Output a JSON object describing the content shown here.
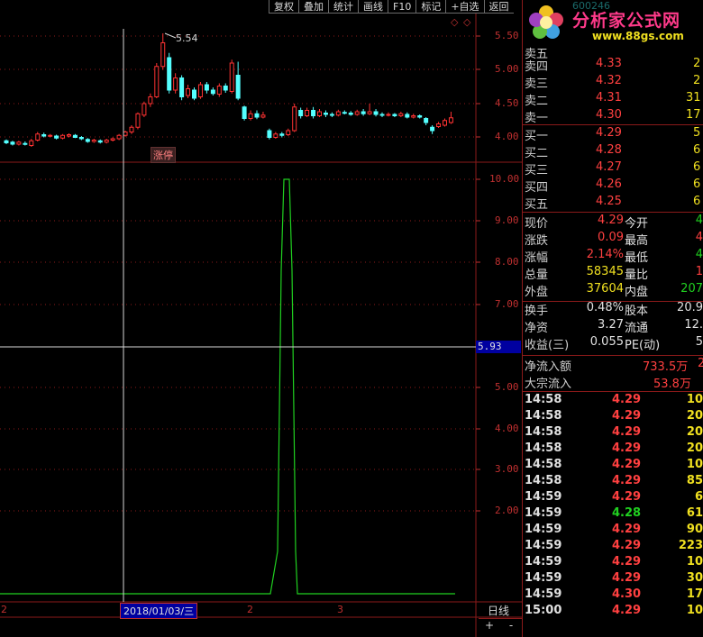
{
  "toolbar": {
    "buttons": [
      "复权",
      "叠加",
      "统计",
      "画线",
      "F10",
      "标记",
      "+自选",
      "返回"
    ]
  },
  "logo": {
    "title": "分析家公式网",
    "url": "www.88gs.com",
    "bg_code": "600246"
  },
  "main_chart": {
    "y_labels": [
      "5.50",
      "5.00",
      "4.50",
      "4.00"
    ],
    "high_marker": "5.54",
    "tag": "涨停"
  },
  "indicator": {
    "y_labels": [
      "10.00",
      "9.00",
      "8.00",
      "7.00",
      "6.00",
      "5.00",
      "4.00",
      "3.00",
      "2.00"
    ],
    "crosshair_value": "5.93"
  },
  "bottom": {
    "axis_left": "2",
    "date_label": "2018/01/03/三",
    "marker_mid": "2",
    "marker_right": "3",
    "period": "日线",
    "zoom_in": "+",
    "zoom_out": "-"
  },
  "chart_data": {
    "type": "candlestick",
    "high_label": "5.54",
    "price_range": [
      3.8,
      5.65
    ],
    "candles": [
      {
        "o": 3.95,
        "c": 3.92,
        "h": 3.97,
        "l": 3.9
      },
      {
        "o": 3.93,
        "c": 3.9,
        "h": 3.95,
        "l": 3.88
      },
      {
        "o": 3.9,
        "c": 3.93,
        "h": 3.95,
        "l": 3.88
      },
      {
        "o": 3.91,
        "c": 3.9,
        "h": 3.94,
        "l": 3.88
      },
      {
        "o": 3.88,
        "c": 3.95,
        "h": 3.98,
        "l": 3.86
      },
      {
        "o": 3.96,
        "c": 4.05,
        "h": 4.08,
        "l": 3.94
      },
      {
        "o": 4.04,
        "c": 4.02,
        "h": 4.07,
        "l": 4.0
      },
      {
        "o": 4.02,
        "c": 4.03,
        "h": 4.05,
        "l": 4.0
      },
      {
        "o": 4.02,
        "c": 3.99,
        "h": 4.04,
        "l": 3.97
      },
      {
        "o": 3.99,
        "c": 4.03,
        "h": 4.05,
        "l": 3.97
      },
      {
        "o": 4.02,
        "c": 4.04,
        "h": 4.06,
        "l": 4.0
      },
      {
        "o": 4.03,
        "c": 4.0,
        "h": 4.05,
        "l": 3.99
      },
      {
        "o": 4.0,
        "c": 3.98,
        "h": 4.02,
        "l": 3.96
      },
      {
        "o": 3.97,
        "c": 3.94,
        "h": 3.99,
        "l": 3.92
      },
      {
        "o": 3.94,
        "c": 3.96,
        "h": 3.98,
        "l": 3.92
      },
      {
        "o": 3.95,
        "c": 3.93,
        "h": 3.97,
        "l": 3.91
      },
      {
        "o": 3.93,
        "c": 3.96,
        "h": 3.98,
        "l": 3.91
      },
      {
        "o": 3.96,
        "c": 3.98,
        "h": 4.0,
        "l": 3.94
      },
      {
        "o": 3.98,
        "c": 4.03,
        "h": 4.05,
        "l": 3.96
      },
      {
        "o": 4.03,
        "c": 4.08,
        "h": 4.1,
        "l": 4.01
      },
      {
        "o": 4.08,
        "c": 4.15,
        "h": 4.18,
        "l": 4.05
      },
      {
        "o": 4.15,
        "c": 4.35,
        "h": 4.37,
        "l": 4.12
      },
      {
        "o": 4.33,
        "c": 4.5,
        "h": 4.53,
        "l": 4.3
      },
      {
        "o": 4.5,
        "c": 4.6,
        "h": 4.65,
        "l": 4.45
      },
      {
        "o": 4.6,
        "c": 5.05,
        "h": 5.1,
        "l": 4.58
      },
      {
        "o": 5.05,
        "c": 5.4,
        "h": 5.54,
        "l": 5.0
      },
      {
        "o": 5.18,
        "c": 4.7,
        "h": 5.25,
        "l": 4.65
      },
      {
        "o": 4.7,
        "c": 4.88,
        "h": 4.95,
        "l": 4.65
      },
      {
        "o": 4.88,
        "c": 4.6,
        "h": 4.92,
        "l": 4.55
      },
      {
        "o": 4.62,
        "c": 4.72,
        "h": 4.78,
        "l": 4.58
      },
      {
        "o": 4.7,
        "c": 4.58,
        "h": 4.74,
        "l": 4.55
      },
      {
        "o": 4.6,
        "c": 4.78,
        "h": 4.82,
        "l": 4.57
      },
      {
        "o": 4.78,
        "c": 4.7,
        "h": 4.82,
        "l": 4.65
      },
      {
        "o": 4.7,
        "c": 4.65,
        "h": 4.74,
        "l": 4.62
      },
      {
        "o": 4.64,
        "c": 4.76,
        "h": 4.8,
        "l": 4.6
      },
      {
        "o": 4.76,
        "c": 4.7,
        "h": 4.8,
        "l": 4.66
      },
      {
        "o": 4.68,
        "c": 5.1,
        "h": 5.15,
        "l": 4.65
      },
      {
        "o": 4.92,
        "c": 4.58,
        "h": 5.12,
        "l": 4.55
      },
      {
        "o": 4.45,
        "c": 4.28,
        "h": 4.47,
        "l": 4.25
      },
      {
        "o": 4.28,
        "c": 4.35,
        "h": 4.4,
        "l": 4.25
      },
      {
        "o": 4.35,
        "c": 4.3,
        "h": 4.4,
        "l": 4.27
      },
      {
        "o": 4.3,
        "c": 4.33,
        "h": 4.38,
        "l": 4.28
      },
      {
        "o": 4.1,
        "c": 4.0,
        "h": 4.13,
        "l": 3.97
      },
      {
        "o": 4.0,
        "c": 4.05,
        "h": 4.08,
        "l": 3.98
      },
      {
        "o": 4.05,
        "c": 4.03,
        "h": 4.08,
        "l": 4.0
      },
      {
        "o": 4.04,
        "c": 4.1,
        "h": 4.13,
        "l": 4.02
      },
      {
        "o": 4.1,
        "c": 4.45,
        "h": 4.5,
        "l": 4.08
      },
      {
        "o": 4.4,
        "c": 4.32,
        "h": 4.44,
        "l": 4.28
      },
      {
        "o": 4.32,
        "c": 4.4,
        "h": 4.44,
        "l": 4.3
      },
      {
        "o": 4.4,
        "c": 4.32,
        "h": 4.45,
        "l": 4.28
      },
      {
        "o": 4.32,
        "c": 4.38,
        "h": 4.42,
        "l": 4.3
      },
      {
        "o": 4.36,
        "c": 4.34,
        "h": 4.4,
        "l": 4.3
      },
      {
        "o": 4.34,
        "c": 4.33,
        "h": 4.37,
        "l": 4.3
      },
      {
        "o": 4.33,
        "c": 4.38,
        "h": 4.41,
        "l": 4.31
      },
      {
        "o": 4.37,
        "c": 4.36,
        "h": 4.4,
        "l": 4.34
      },
      {
        "o": 4.36,
        "c": 4.34,
        "h": 4.39,
        "l": 4.32
      },
      {
        "o": 4.34,
        "c": 4.38,
        "h": 4.41,
        "l": 4.32
      },
      {
        "o": 4.38,
        "c": 4.35,
        "h": 4.42,
        "l": 4.32
      },
      {
        "o": 4.35,
        "c": 4.38,
        "h": 4.5,
        "l": 4.33
      },
      {
        "o": 4.38,
        "c": 4.34,
        "h": 4.42,
        "l": 4.31
      },
      {
        "o": 4.34,
        "c": 4.33,
        "h": 4.37,
        "l": 4.3
      },
      {
        "o": 4.33,
        "c": 4.34,
        "h": 4.37,
        "l": 4.31
      },
      {
        "o": 4.34,
        "c": 4.32,
        "h": 4.36,
        "l": 4.3
      },
      {
        "o": 4.32,
        "c": 4.35,
        "h": 4.38,
        "l": 4.3
      },
      {
        "o": 4.34,
        "c": 4.3,
        "h": 4.37,
        "l": 4.28
      },
      {
        "o": 4.3,
        "c": 4.32,
        "h": 4.35,
        "l": 4.28
      },
      {
        "o": 4.32,
        "c": 4.3,
        "h": 4.34,
        "l": 4.28
      },
      {
        "o": 4.28,
        "c": 4.22,
        "h": 4.3,
        "l": 4.18
      },
      {
        "o": 4.15,
        "c": 4.1,
        "h": 4.18,
        "l": 4.05
      },
      {
        "o": 4.16,
        "c": 4.2,
        "h": 4.23,
        "l": 4.14
      },
      {
        "o": 4.18,
        "c": 4.25,
        "h": 4.28,
        "l": 4.16
      },
      {
        "o": 4.22,
        "c": 4.29,
        "h": 4.38,
        "l": 4.2
      }
    ]
  },
  "quotes": {
    "sell": [
      {
        "label": "卖五",
        "price": "",
        "vol": ""
      },
      {
        "label": "卖四",
        "price": "4.33",
        "vol": "2"
      },
      {
        "label": "卖三",
        "price": "4.32",
        "vol": "2"
      },
      {
        "label": "卖二",
        "price": "4.31",
        "vol": "31"
      },
      {
        "label": "卖一",
        "price": "4.30",
        "vol": "17"
      }
    ],
    "buy": [
      {
        "label": "买一",
        "price": "4.29",
        "vol": "5"
      },
      {
        "label": "买二",
        "price": "4.28",
        "vol": "6"
      },
      {
        "label": "买三",
        "price": "4.27",
        "vol": "6"
      },
      {
        "label": "买四",
        "price": "4.26",
        "vol": "6"
      },
      {
        "label": "买五",
        "price": "4.25",
        "vol": "6"
      }
    ]
  },
  "stats": [
    {
      "l1": "现价",
      "v1": "4.29",
      "c1": "red",
      "l2": "今开",
      "v2": "4",
      "c2": "grn"
    },
    {
      "l1": "涨跌",
      "v1": "0.09",
      "c1": "red",
      "l2": "最高",
      "v2": "4",
      "c2": "red"
    },
    {
      "l1": "涨幅",
      "v1": "2.14%",
      "c1": "red",
      "l2": "最低",
      "v2": "4",
      "c2": "grn"
    },
    {
      "l1": "总量",
      "v1": "58345",
      "c1": "yel",
      "l2": "量比",
      "v2": "1",
      "c2": "red"
    },
    {
      "l1": "外盘",
      "v1": "37604",
      "c1": "yel",
      "l2": "内盘",
      "v2": "207",
      "c2": "grn"
    },
    {
      "l1": "换手",
      "v1": "0.48%",
      "c1": "wht",
      "l2": "股本",
      "v2": "20.9",
      "c2": "wht"
    },
    {
      "l1": "净资",
      "v1": "3.27",
      "c1": "wht",
      "l2": "流通",
      "v2": "12.",
      "c2": "wht"
    },
    {
      "l1": "收益(三)",
      "v1": "0.055",
      "c1": "wht",
      "l2": "PE(动)",
      "v2": "5",
      "c2": "wht"
    }
  ],
  "flows": [
    {
      "label": "净流入额",
      "value": "733.5万",
      "extra": "2"
    },
    {
      "label": "大宗流入",
      "value": "53.8万",
      "extra": ""
    }
  ],
  "ticks": [
    {
      "time": "14:58",
      "price": "4.29",
      "vol": "10",
      "c": "red"
    },
    {
      "time": "14:58",
      "price": "4.29",
      "vol": "20",
      "c": "red"
    },
    {
      "time": "14:58",
      "price": "4.29",
      "vol": "20",
      "c": "red"
    },
    {
      "time": "14:58",
      "price": "4.29",
      "vol": "20",
      "c": "red"
    },
    {
      "time": "14:58",
      "price": "4.29",
      "vol": "10",
      "c": "red"
    },
    {
      "time": "14:58",
      "price": "4.29",
      "vol": "85",
      "c": "red"
    },
    {
      "time": "14:59",
      "price": "4.29",
      "vol": "6",
      "c": "red"
    },
    {
      "time": "14:59",
      "price": "4.28",
      "vol": "61",
      "c": "grn"
    },
    {
      "time": "14:59",
      "price": "4.29",
      "vol": "90",
      "c": "red"
    },
    {
      "time": "14:59",
      "price": "4.29",
      "vol": "223",
      "c": "red"
    },
    {
      "time": "14:59",
      "price": "4.29",
      "vol": "10",
      "c": "red"
    },
    {
      "time": "14:59",
      "price": "4.29",
      "vol": "30",
      "c": "red"
    },
    {
      "time": "14:59",
      "price": "4.30",
      "vol": "17",
      "c": "red"
    },
    {
      "time": "15:00",
      "price": "4.29",
      "vol": "10",
      "c": "red"
    }
  ],
  "colors": {
    "up": "#ff3232",
    "down": "#54ffff",
    "grid": "#8b1a1a",
    "indicator": "#20d020",
    "axis": "#c03030"
  }
}
